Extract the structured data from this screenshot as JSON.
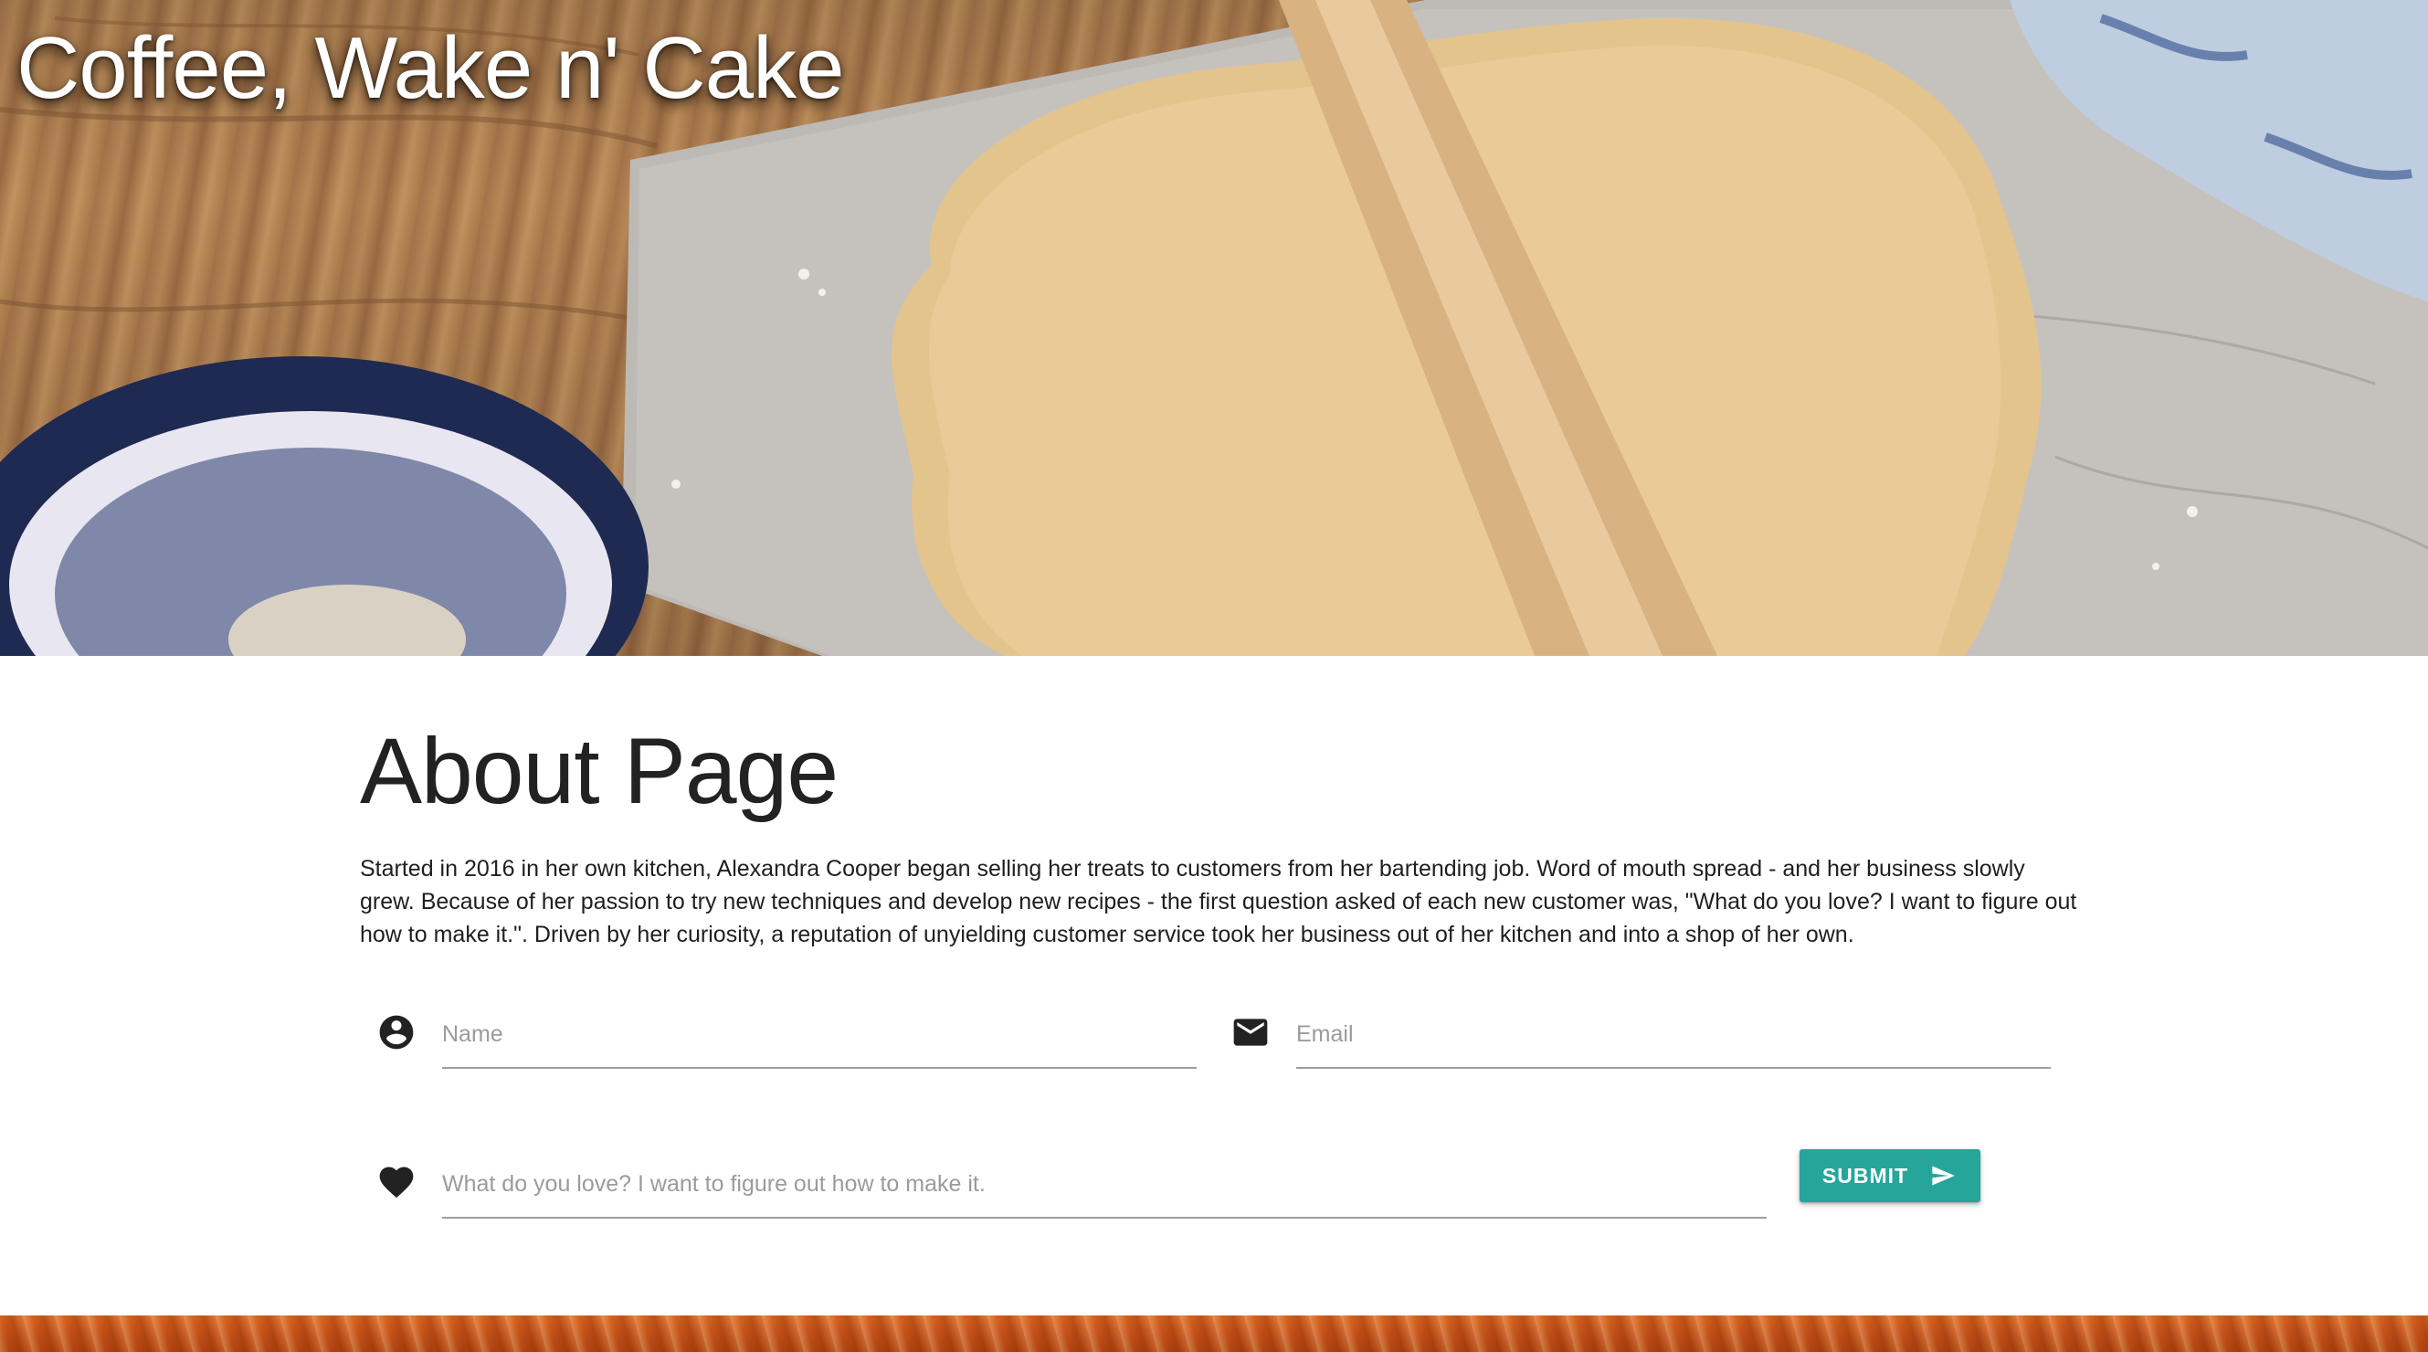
{
  "site": {
    "title": "Coffee, Wake n' Cake"
  },
  "about": {
    "heading": "About Page",
    "body": "Started in 2016 in her own kitchen, Alexandra Cooper began selling her treats to customers from her bartending job. Word of mouth spread - and her business slowly grew. Because of her passion to try new techniques and develop new recipes - the first question asked of each new customer was, \"What do you love? I want to figure out how to make it.\". Driven by her curiosity, a reputation of unyielding customer service took her business out of her kitchen and into a shop of her own."
  },
  "form": {
    "name": {
      "placeholder": "Name",
      "value": "",
      "icon": "account-circle-icon"
    },
    "email": {
      "placeholder": "Email",
      "value": "",
      "icon": "mail-icon"
    },
    "love": {
      "placeholder": "What do you love? I want to figure out how to make it.",
      "value": "",
      "icon": "heart-icon"
    },
    "submit": {
      "label": "SUBMIT",
      "icon": "send-icon"
    }
  },
  "colors": {
    "accent": "#26a69a",
    "text": "#1f1f1f",
    "placeholder": "#9b9b9b",
    "underline": "#9e9e9e"
  }
}
